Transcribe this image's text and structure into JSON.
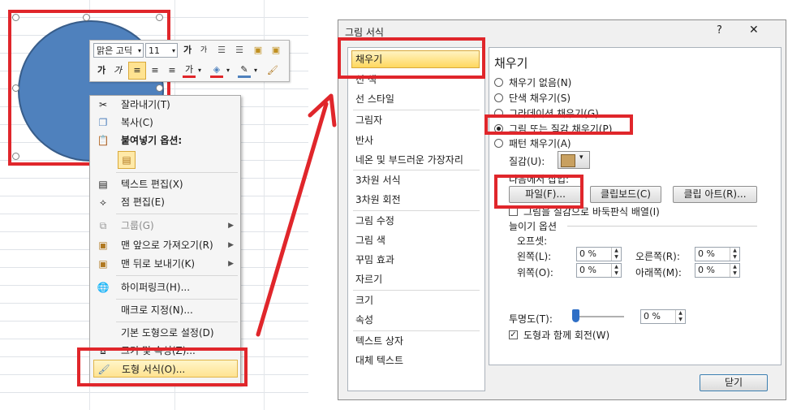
{
  "mini_toolbar": {
    "font_name": "맑은 고딕",
    "font_size": "11",
    "grow_font": "가",
    "shrink_font": "가",
    "bold": "가",
    "italic": "가",
    "font_color_glyph": "가"
  },
  "context_menu": {
    "items": [
      {
        "label": "잘라내기(T)",
        "icon": "scissors-icon"
      },
      {
        "label": "복사(C)",
        "icon": "copy-icon"
      },
      {
        "label": "붙여넣기 옵션:",
        "icon": "paste-icon"
      },
      {
        "label": "텍스트 편집(X)",
        "icon": "edit-text-icon"
      },
      {
        "label": "점 편집(E)",
        "icon": "edit-points-icon"
      },
      {
        "label": "그룹(G)",
        "icon": "group-icon"
      },
      {
        "label": "맨 앞으로 가져오기(R)",
        "icon": "bring-front-icon"
      },
      {
        "label": "맨 뒤로 보내기(K)",
        "icon": "send-back-icon"
      },
      {
        "label": "하이퍼링크(H)...",
        "icon": "hyperlink-icon"
      },
      {
        "label": "매크로 지정(N)...",
        "icon": ""
      },
      {
        "label": "기본 도형으로 설정(D)",
        "icon": ""
      },
      {
        "label": "크기 및 속성(Z)...",
        "icon": "size-props-icon"
      },
      {
        "label": "도형 서식(O)...",
        "icon": "format-shape-icon"
      }
    ]
  },
  "dialog": {
    "title": "그림 서식",
    "help": "?",
    "close": "✕",
    "categories": [
      "채우기",
      "선 색",
      "선 스타일",
      "그림자",
      "반사",
      "네온 및 부드러운 가장자리",
      "3차원 서식",
      "3차원 회전",
      "그림 수정",
      "그림 색",
      "꾸밈 효과",
      "자르기",
      "크기",
      "속성",
      "텍스트 상자",
      "대체 텍스트"
    ],
    "section_title": "채우기",
    "fill_options": [
      "채우기 없음(N)",
      "단색 채우기(S)",
      "그라데이션 채우기(G)",
      "그림 또는 질감 채우기(P)",
      "패턴 채우기(A)"
    ],
    "texture_label": "질감(U):",
    "insert_from_label": "다음에서 삽입:",
    "btn_file": "파일(F)...",
    "btn_clipboard": "클립보드(C)",
    "btn_clipart": "클립 아트(R)...",
    "tile_label": "그림을 질감으로 바둑판식 배열(I)",
    "stretch_label": "늘이기 옵션",
    "offset_label": "오프셋:",
    "left_label": "왼쪽(L):",
    "right_label": "오른쪽(R):",
    "top_label": "위쪽(O):",
    "bottom_label": "아래쪽(M):",
    "offset_left": "0 %",
    "offset_right": "0 %",
    "offset_top": "0 %",
    "offset_bottom": "0 %",
    "transparency_label": "투명도(T):",
    "transparency_value": "0 %",
    "rotate_label": "도형과 함께 회전(W)",
    "btn_close": "닫기"
  }
}
